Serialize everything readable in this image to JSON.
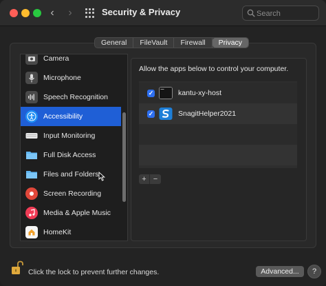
{
  "window": {
    "title": "Security & Privacy",
    "back_glyph": "‹",
    "forward_glyph": "›"
  },
  "search": {
    "placeholder": "Search"
  },
  "tabs": [
    {
      "label": "General",
      "active": false
    },
    {
      "label": "FileVault",
      "active": false
    },
    {
      "label": "Firewall",
      "active": false
    },
    {
      "label": "Privacy",
      "active": true
    }
  ],
  "sidebar": {
    "items": [
      {
        "label": "Camera",
        "icon": "camera-icon",
        "color": "#4a4a4a",
        "selected": false
      },
      {
        "label": "Microphone",
        "icon": "microphone-icon",
        "color": "#4a4a4a",
        "selected": false
      },
      {
        "label": "Speech Recognition",
        "icon": "speech-waveform-icon",
        "color": "#4a4a4a",
        "selected": false
      },
      {
        "label": "Accessibility",
        "icon": "accessibility-icon",
        "color": "#1f8ff5",
        "selected": true
      },
      {
        "label": "Input Monitoring",
        "icon": "keyboard-icon",
        "color": "#e8e8e8",
        "selected": false
      },
      {
        "label": "Full Disk Access",
        "icon": "folder-icon",
        "color": "#5fb6f2",
        "selected": false
      },
      {
        "label": "Files and Folders",
        "icon": "folder-icon",
        "color": "#5fb6f2",
        "selected": false
      },
      {
        "label": "Screen Recording",
        "icon": "screen-record-icon",
        "color": "#e0473a",
        "selected": false
      },
      {
        "label": "Media & Apple Music",
        "icon": "music-icon",
        "color": "#ef3b55",
        "selected": false
      },
      {
        "label": "HomeKit",
        "icon": "home-icon",
        "color": "#f5f5f5",
        "selected": false
      }
    ]
  },
  "pane": {
    "description": "Allow the apps below to control your computer.",
    "apps": [
      {
        "name": "kantu-xy-host",
        "checked": true,
        "icon": "terminal-icon",
        "check_glyph": "✓"
      },
      {
        "name": "SnagitHelper2021",
        "checked": true,
        "icon": "snagit-icon",
        "check_glyph": "✓"
      }
    ],
    "add_glyph": "+",
    "remove_glyph": "−"
  },
  "footer": {
    "lock_text": "Click the lock to prevent further changes.",
    "advanced_label": "Advanced...",
    "help_label": "?"
  },
  "colors": {
    "accent": "#1f5fd6",
    "checkbox": "#2d6ff0"
  }
}
